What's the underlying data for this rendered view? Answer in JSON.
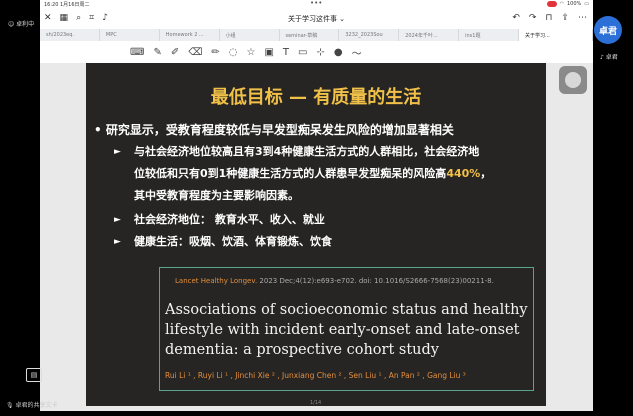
{
  "status_bar": {
    "time_date": "16:20  1月16日周二",
    "dots": "•••",
    "battery": "100%"
  },
  "nav": {
    "doc_title": "关于学习这件事 ⌄"
  },
  "tabs": [
    "sh/2023eq.",
    "MPC",
    "Homework 2 ...",
    "小组",
    "seminar-草稿",
    "3232_2023Sou",
    "2024年千叶...",
    "ins1题",
    "关于学习..."
  ],
  "left_panel": {
    "user_label": "卓利中",
    "bottom_label": "卓君的共享文卡"
  },
  "right_panel": {
    "avatar_text": "卓君",
    "user_label": "卓君"
  },
  "slide": {
    "title": "最低目标 — 有质量的生活",
    "bullet_main": "研究显示，受教育程度较低与早发型痴呆发生风险的增加显著相关",
    "sub1_line1": "与社会经济地位较高且有3到4种健康生活方式的人群相比，社会经济地",
    "sub1_line2_a": "位较低和只有0到1种健康生活方式的人群患早发型痴呆的风险高",
    "sub1_highlight": "440%",
    "sub1_line2_b": "，",
    "sub1_line3": "其中受教育程度为主要影响因素。",
    "sub2": "社会经济地位：  教育水平、收入、就业",
    "sub3": "健康生活：吸烟、饮酒、体育锻炼、饮食",
    "citation": {
      "journal": "Lancet Healthy Longev.",
      "ref_rest": " 2023 Dec;4(12):e693-e702. doi: 10.1016/S2666-7568(23)00211-8.",
      "title": "Associations of socioeconomic status and healthy lifestyle with incident early-onset and late-onset dementia: a prospective cohort study",
      "authors": "Rui Li ¹ , Ruyi Li ¹ , Jinchi Xie ² , Junxiang Chen ² , Sen Liu ¹ , An Pan ² , Gang Liu ³"
    },
    "page_number": "1/14"
  },
  "colors": {
    "accent_yellow": "#f0c048",
    "author_orange": "#e58e3a",
    "box_teal": "#5aa38f"
  }
}
